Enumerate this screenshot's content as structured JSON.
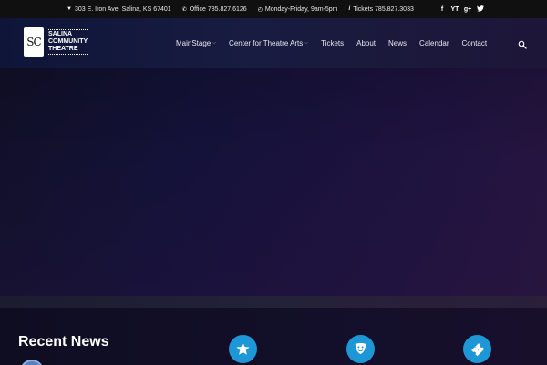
{
  "topbar": {
    "address": "303 E. Iron Ave. Salina, KS 67401",
    "office": "Office 785.827.6126",
    "hours": "Monday-Friday, 9am-5pm",
    "tickets": "Tickets 785.827.3033",
    "icons": [
      "map-pin-icon",
      "phone-icon",
      "clock-icon",
      "info-icon"
    ],
    "social": [
      "f",
      "YT",
      "g+",
      "twitter-bird"
    ]
  },
  "logo": {
    "mark": "SC",
    "line1": "SALINA",
    "line2": "COMMUNITY",
    "line3": "THEATRE"
  },
  "nav": {
    "items": [
      {
        "label": "MainStage",
        "dropdown": true
      },
      {
        "label": "Center for Theatre Arts",
        "dropdown": true
      },
      {
        "label": "Tickets",
        "dropdown": false
      },
      {
        "label": "About",
        "dropdown": false
      },
      {
        "label": "News",
        "dropdown": false
      },
      {
        "label": "Calendar",
        "dropdown": false
      },
      {
        "label": "Contact",
        "dropdown": false
      }
    ],
    "search_icon": "search-icon"
  },
  "recent_news": {
    "title": "Recent News"
  },
  "features": {
    "icons": [
      "star-icon",
      "theatre-mask-icon",
      "ticket-icon"
    ],
    "accent": "#1d97d6"
  },
  "colors": {
    "topbar_bg": "#101010",
    "header_bg": "#171c40",
    "hero_bg": "#14123a",
    "accent": "#1d97d6"
  }
}
